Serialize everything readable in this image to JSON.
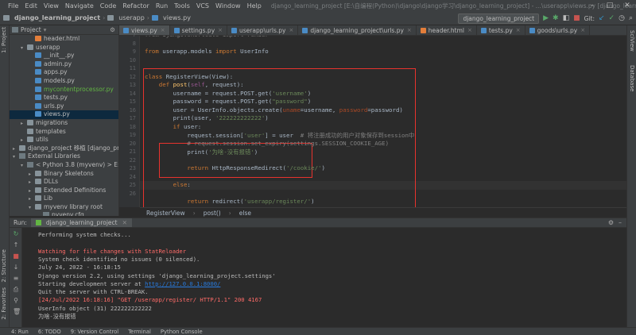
{
  "menubar": {
    "items": [
      "File",
      "Edit",
      "View",
      "Navigate",
      "Code",
      "Refactor",
      "Run",
      "Tools",
      "VCS",
      "Window",
      "Help"
    ],
    "window_title": "django_learning_project [E:\\自编程(Python)\\django\\django学习\\django_learning_project] - ...\\userapp\\views.py [django_learning_project]"
  },
  "navbar": {
    "crumbs": [
      "django_learning_project",
      "userapp",
      "views.py"
    ],
    "run_config": "django_learning_project",
    "git_label": "Git:"
  },
  "side_tabs": {
    "left": [
      "1: Project",
      "2: Structure",
      "2: Favorites"
    ],
    "right": [
      "SciView",
      "Database"
    ]
  },
  "project": {
    "header": "Project",
    "rows": [
      {
        "indent": 2,
        "arrow": "",
        "icon": "htm",
        "label": "header.html",
        "cls": ""
      },
      {
        "indent": 1,
        "arrow": "▾",
        "icon": "fold",
        "label": "userapp",
        "cls": ""
      },
      {
        "indent": 2,
        "arrow": "",
        "icon": "pyf",
        "label": "__init__.py",
        "cls": ""
      },
      {
        "indent": 2,
        "arrow": "",
        "icon": "pyf",
        "label": "admin.py",
        "cls": ""
      },
      {
        "indent": 2,
        "arrow": "",
        "icon": "pyf",
        "label": "apps.py",
        "cls": ""
      },
      {
        "indent": 2,
        "arrow": "",
        "icon": "pyf",
        "label": "models.py",
        "cls": ""
      },
      {
        "indent": 2,
        "arrow": "",
        "icon": "pyf",
        "label": "mycontentprocessor.py",
        "cls": "green"
      },
      {
        "indent": 2,
        "arrow": "",
        "icon": "pyf",
        "label": "tests.py",
        "cls": ""
      },
      {
        "indent": 2,
        "arrow": "",
        "icon": "pyf",
        "label": "urls.py",
        "cls": ""
      },
      {
        "indent": 2,
        "arrow": "",
        "icon": "pyf",
        "label": "views.py",
        "cls": "sel"
      },
      {
        "indent": 1,
        "arrow": "▸",
        "icon": "fold",
        "label": "migrations",
        "cls": ""
      },
      {
        "indent": 1,
        "arrow": "",
        "icon": "fold",
        "label": "templates",
        "cls": ""
      },
      {
        "indent": 1,
        "arrow": "▸",
        "icon": "fold",
        "label": "utils",
        "cls": ""
      },
      {
        "indent": 0,
        "arrow": "▸",
        "icon": "fold",
        "label": "django_project 移植 [django_project]",
        "cls": ""
      },
      {
        "indent": 0,
        "arrow": "▾",
        "icon": "libf",
        "label": "External Libraries",
        "cls": ""
      },
      {
        "indent": 1,
        "arrow": "▾",
        "icon": "libf",
        "label": "< Python 3.8 (myvenv) > E:\\js爬虫\\my...",
        "cls": ""
      },
      {
        "indent": 2,
        "arrow": "▸",
        "icon": "fold",
        "label": "Binary Skeletons",
        "cls": ""
      },
      {
        "indent": 2,
        "arrow": "▸",
        "icon": "fold",
        "label": "DLLs",
        "cls": ""
      },
      {
        "indent": 2,
        "arrow": "▸",
        "icon": "fold",
        "label": "Extended Definitions",
        "cls": ""
      },
      {
        "indent": 2,
        "arrow": "▸",
        "icon": "fold",
        "label": "Lib",
        "cls": ""
      },
      {
        "indent": 2,
        "arrow": "▾",
        "icon": "fold",
        "label": "myvenv library root",
        "cls": ""
      },
      {
        "indent": 3,
        "arrow": "",
        "icon": "libf",
        "label": "pyvenv.cfg",
        "cls": ""
      }
    ]
  },
  "tabs": [
    {
      "label": "views.py",
      "active": true
    },
    {
      "label": "settings.py",
      "active": false
    },
    {
      "label": "userapp\\urls.py",
      "active": false
    },
    {
      "label": "django_learning_project\\urls.py",
      "active": false
    },
    {
      "label": "header.html",
      "active": false
    },
    {
      "label": "tests.py",
      "active": false
    },
    {
      "label": "goods\\urls.py",
      "active": false
    }
  ],
  "editor": {
    "line_numbers": [
      "7",
      "8",
      "9",
      "10",
      "11",
      "12",
      "13",
      "14",
      "15",
      "16",
      "17",
      "18",
      "19",
      "20",
      "21",
      "22",
      "23",
      "24",
      "25",
      "26"
    ],
    "lines": [
      [
        {
          "t": "from django.shortcuts import render",
          "c": "cm"
        }
      ],
      [],
      [
        {
          "t": "from ",
          "c": "kw"
        },
        {
          "t": "userapp.models ",
          "c": ""
        },
        {
          "t": "import ",
          "c": "kw"
        },
        {
          "t": "UserInfo",
          "c": ""
        }
      ],
      [],
      [],
      [
        {
          "t": "class ",
          "c": "kw"
        },
        {
          "t": "RegisterView(View):",
          "c": ""
        }
      ],
      [
        {
          "t": "    def ",
          "c": "kw"
        },
        {
          "t": "post",
          "c": "fn"
        },
        {
          "t": "(",
          "c": ""
        },
        {
          "t": "self",
          "c": "self"
        },
        {
          "t": ", request):",
          "c": ""
        }
      ],
      [
        {
          "t": "        username = request.POST.get(",
          "c": ""
        },
        {
          "t": "'username'",
          "c": "st"
        },
        {
          "t": ")",
          "c": ""
        }
      ],
      [
        {
          "t": "        password = request.POST.get(",
          "c": ""
        },
        {
          "t": "\"password\"",
          "c": "st"
        },
        {
          "t": ")",
          "c": ""
        }
      ],
      [
        {
          "t": "        user = UserInfo.objects.create(",
          "c": ""
        },
        {
          "t": "uname",
          "c": "np"
        },
        {
          "t": "=username, ",
          "c": ""
        },
        {
          "t": "password",
          "c": "np"
        },
        {
          "t": "=password)",
          "c": ""
        }
      ],
      [
        {
          "t": "        print(user, ",
          "c": ""
        },
        {
          "t": "'222222222222'",
          "c": "st"
        },
        {
          "t": ")",
          "c": ""
        }
      ],
      [
        {
          "t": "        ",
          "c": ""
        },
        {
          "t": "if ",
          "c": "kw"
        },
        {
          "t": "user:",
          "c": ""
        }
      ],
      [
        {
          "t": "            request.session[",
          "c": ""
        },
        {
          "t": "'user'",
          "c": "st"
        },
        {
          "t": "] = user  ",
          "c": ""
        },
        {
          "t": "# 将注册成功的用户对象保存到session中",
          "c": "cm"
        }
      ],
      [
        {
          "t": "            # request.session.set_expiry(settings.SESSION_COOKIE_AGE)",
          "c": "cm"
        }
      ],
      [
        {
          "t": "            print(",
          "c": ""
        },
        {
          "t": "'为啥-没有报错'",
          "c": "st"
        },
        {
          "t": ")",
          "c": ""
        }
      ],
      [],
      [
        {
          "t": "            ",
          "c": ""
        },
        {
          "t": "return ",
          "c": "kw"
        },
        {
          "t": "HttpResponseRedirect(",
          "c": ""
        },
        {
          "t": "'/cookie/'",
          "c": "st"
        },
        {
          "t": ")",
          "c": ""
        }
      ],
      [],
      [
        {
          "t": "        ",
          "c": ""
        },
        {
          "t": "else",
          "c": "kw"
        },
        {
          "t": ":",
          "c": ""
        }
      ],
      [],
      [
        {
          "t": "            ",
          "c": ""
        },
        {
          "t": "return ",
          "c": "kw"
        },
        {
          "t": "redirect(",
          "c": ""
        },
        {
          "t": "'userapp/register/'",
          "c": "st"
        },
        {
          "t": ")",
          "c": ""
        }
      ]
    ]
  },
  "breadcrumb2": [
    "RegisterView",
    "post()",
    "else"
  ],
  "run": {
    "label": "Run:",
    "tab": "django_learning_project",
    "lines": [
      {
        "t": "Performing system checks...",
        "c": "cw"
      },
      {
        "t": "",
        "c": "cw"
      },
      {
        "t": "Watching for file changes with StatReloader",
        "c": "cr"
      },
      {
        "t": "System check identified no issues (0 silenced).",
        "c": "cw"
      },
      {
        "t": "July 24, 2022 - 16:18:15",
        "c": "cw"
      },
      {
        "t": "Django version 2.2, using settings 'django_learning_project.settings'",
        "c": "cw"
      },
      {
        "t": "Starting development server at ",
        "c": "cw",
        "link": "http://127.0.0.1:8000/"
      },
      {
        "t": "Quit the server with CTRL-BREAK.",
        "c": "cw"
      },
      {
        "t": "[24/Jul/2022 16:18:16] \"GET /userapp/register/ HTTP/1.1\" 200 4167",
        "c": "cr"
      },
      {
        "t": "UserInfo object (31) 222222222222",
        "c": "cw"
      },
      {
        "t": "为啥-没有报错",
        "c": "cw"
      }
    ]
  },
  "statusbar": [
    "4: Run",
    "6: TODO",
    "9: Version Control",
    "Terminal",
    "Python Console"
  ],
  "colors": {
    "accent": "#e8332e",
    "keyword": "#cc7832",
    "string": "#6a8759",
    "link": "#287bde",
    "error": "#ff6b68"
  }
}
